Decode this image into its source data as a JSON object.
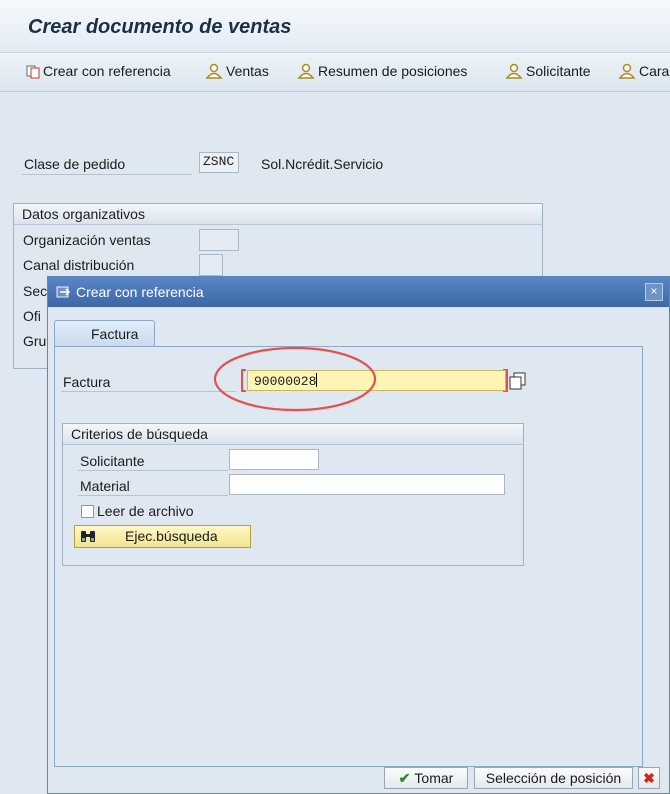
{
  "window": {
    "title": "Crear documento de ventas"
  },
  "toolbar": {
    "create_with_reference": "Crear con referencia",
    "sales": "Ventas",
    "item_overview": "Resumen de posiciones",
    "ordering_party": "Solicitante",
    "cara": "Cara"
  },
  "order": {
    "type_label": "Clase de pedido",
    "type_value": "ZSNC",
    "type_desc": "Sol.Ncrédit.Servicio"
  },
  "org": {
    "title": "Datos organizativos",
    "sales_org": "Organización ventas",
    "distribution_channel": "Canal distribución",
    "sec_truncated": "Sec",
    "ofi_truncated": "Ofi",
    "gru_truncated": "Gru"
  },
  "dialog": {
    "title": "Crear con referencia",
    "tab_label": "Factura",
    "factura_label": "Factura",
    "factura_value": "90000028",
    "search_title": "Criterios de búsqueda",
    "solicitante_label": "Solicitante",
    "material_label": "Material",
    "archive_label": "Leer de archivo",
    "search_button": "Ejec.búsqueda",
    "take_button": "Tomar",
    "select_position_button": "Selección de posición",
    "close_symbol": "×"
  },
  "colors": {
    "accent": "#3c68a8",
    "highlight": "#e0524f",
    "input_yellow": "#fdf5b3"
  },
  "icons": [
    "copy-icon",
    "person-icon",
    "binoculars-icon",
    "checkmark-icon",
    "cancel-icon",
    "search-help-icon"
  ]
}
